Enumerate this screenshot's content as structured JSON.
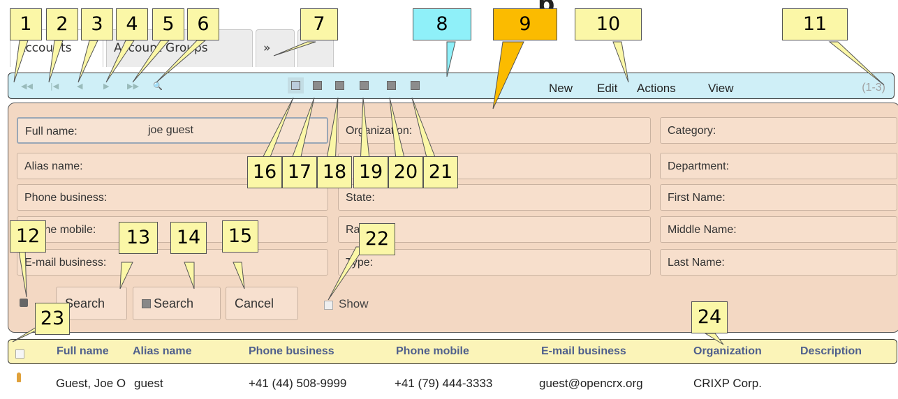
{
  "page": {
    "title_fragment": "p"
  },
  "tabs": [
    {
      "label": "Accounts"
    },
    {
      "label": "Account Groups"
    },
    {
      "label": "»"
    },
    {
      "label": ""
    }
  ],
  "toolbar": {
    "nav_icons": [
      "first-page-icon",
      "prev-page-icon",
      "prev-icon",
      "next-icon",
      "last-page-icon",
      "search-icon"
    ],
    "tool_icons": [
      "clear-filter-icon",
      "save-icon",
      "print-icon",
      "settings-icon",
      "select-icon",
      "layout-icon"
    ],
    "menu": {
      "new": "New",
      "edit": "Edit",
      "actions": "Actions",
      "view": "View"
    },
    "count": "(1-3)"
  },
  "search_panel": {
    "fields_col1": [
      {
        "label": "Full name:",
        "value": "joe guest"
      },
      {
        "label": "Alias name:"
      },
      {
        "label": "Phone business:"
      },
      {
        "label": "Phone mobile:"
      },
      {
        "label": "E-mail business:"
      }
    ],
    "fields_col2": [
      {
        "label": "Organization:"
      },
      {
        "label": ""
      },
      {
        "label": "State:"
      },
      {
        "label": "Rating:"
      },
      {
        "label": "Type:"
      }
    ],
    "fields_col3": [
      {
        "label": "Category:"
      },
      {
        "label": "Department:"
      },
      {
        "label": "First Name:"
      },
      {
        "label": "Middle Name:"
      },
      {
        "label": "Last Name:"
      }
    ],
    "buttons": {
      "search": "Search",
      "search_clear": "Search",
      "cancel": "Cancel"
    },
    "show_label": "Show"
  },
  "grid": {
    "columns": [
      "Full name",
      "Alias name",
      "Phone business",
      "Phone mobile",
      "E-mail business",
      "Organization",
      "Description"
    ],
    "rows": [
      [
        "Guest, Joe O",
        "guest",
        "+41 (44) 508-9999",
        "+41 (79) 444-3333",
        "guest@opencrx.org",
        "CRIXP Corp.",
        ""
      ]
    ]
  },
  "callouts": [
    "1",
    "2",
    "3",
    "4",
    "5",
    "6",
    "7",
    "8",
    "9",
    "10",
    "11",
    "12",
    "13",
    "14",
    "15",
    "16",
    "17",
    "18",
    "19",
    "20",
    "21",
    "22",
    "23",
    "24"
  ],
  "colors": {
    "toolbar_bg": "#cfeff7",
    "panel_bg": "#f3d8c3",
    "grid_header_bg": "#fbf4b8",
    "callout_bg": "#fbf7a7",
    "callout_cyan": "#8ff0f9",
    "callout_orange": "#fbbb00",
    "column_header_text": "#4f5f8c"
  }
}
